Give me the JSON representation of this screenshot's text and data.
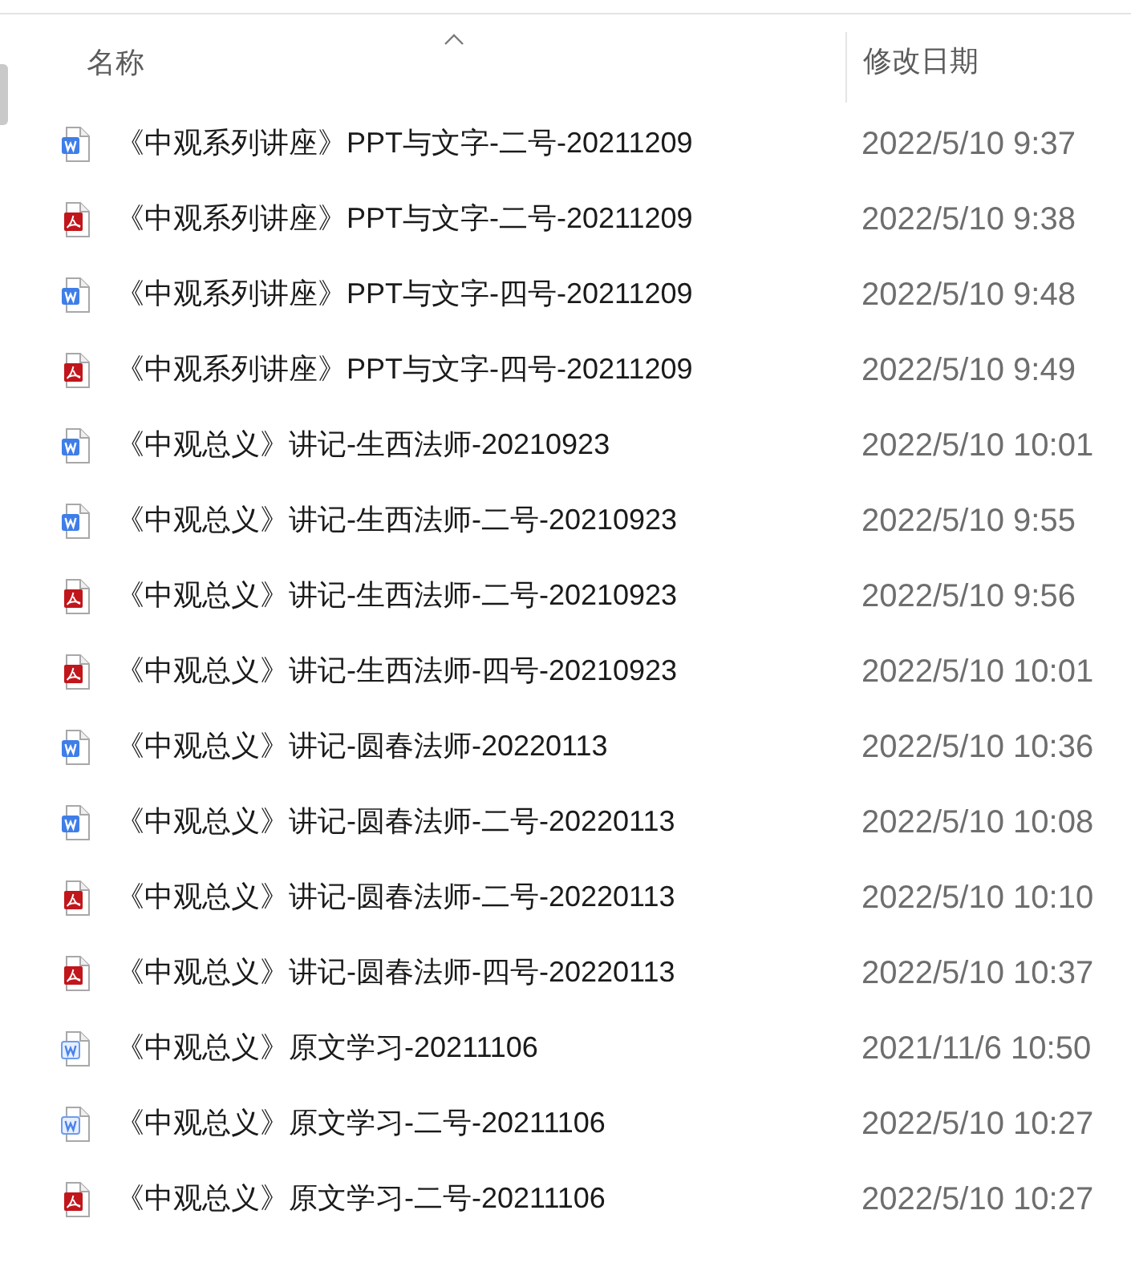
{
  "columns": [
    {
      "label": "名称",
      "sorted": true
    },
    {
      "label": "修改日期",
      "sorted": false
    }
  ],
  "files": [
    {
      "kind": "word",
      "name": "《中观系列讲座》PPT与文字-二号-20211209",
      "modified": "2022/5/10 9:37"
    },
    {
      "kind": "pdf",
      "name": "《中观系列讲座》PPT与文字-二号-20211209",
      "modified": "2022/5/10 9:38"
    },
    {
      "kind": "word",
      "name": "《中观系列讲座》PPT与文字-四号-20211209",
      "modified": "2022/5/10 9:48"
    },
    {
      "kind": "pdf",
      "name": "《中观系列讲座》PPT与文字-四号-20211209",
      "modified": "2022/5/10 9:49"
    },
    {
      "kind": "word",
      "name": "《中观总义》讲记-生西法师-20210923",
      "modified": "2022/5/10 10:01"
    },
    {
      "kind": "word",
      "name": "《中观总义》讲记-生西法师-二号-20210923",
      "modified": "2022/5/10 9:55"
    },
    {
      "kind": "pdf",
      "name": "《中观总义》讲记-生西法师-二号-20210923",
      "modified": "2022/5/10 9:56"
    },
    {
      "kind": "pdf",
      "name": "《中观总义》讲记-生西法师-四号-20210923",
      "modified": "2022/5/10 10:01"
    },
    {
      "kind": "word",
      "name": "《中观总义》讲记-圆春法师-20220113",
      "modified": "2022/5/10 10:36"
    },
    {
      "kind": "word",
      "name": "《中观总义》讲记-圆春法师-二号-20220113",
      "modified": "2022/5/10 10:08"
    },
    {
      "kind": "pdf",
      "name": "《中观总义》讲记-圆春法师-二号-20220113",
      "modified": "2022/5/10 10:10"
    },
    {
      "kind": "pdf",
      "name": "《中观总义》讲记-圆春法师-四号-20220113",
      "modified": "2022/5/10 10:37"
    },
    {
      "kind": "legacy_word",
      "name": "《中观总义》原文学习-20211106",
      "modified": "2021/11/6 10:50"
    },
    {
      "kind": "legacy_word",
      "name": "《中观总义》原文学习-二号-20211106",
      "modified": "2022/5/10 10:27"
    },
    {
      "kind": "pdf",
      "name": "《中观总义》原文学习-二号-20211106",
      "modified": "2022/5/10 10:27"
    }
  ]
}
